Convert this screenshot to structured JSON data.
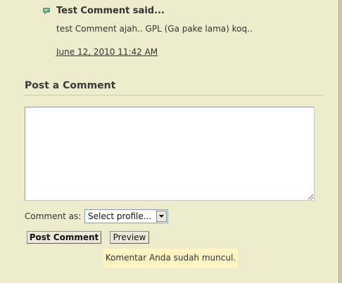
{
  "comment": {
    "icon": "speech-bubble-icon",
    "author_line": "Test Comment said...",
    "body": "test Comment ajah.. GPL (Ga pake lama) koq..",
    "timestamp": "June 12, 2010 11:42 AM"
  },
  "post_comment": {
    "heading": "Post a Comment",
    "textarea_value": "",
    "comment_as_label": "Comment as:",
    "profile_select": {
      "selected": "Select profile...",
      "arrow_icon": "chevron-down-icon"
    },
    "post_button_label": "Post Comment",
    "preview_button_label": "Preview",
    "notice": "Komentar Anda sudah muncul."
  },
  "colors": {
    "background": "#eeeccd",
    "notice_background": "#fff4c2",
    "comment_icon": "#5a9a7a"
  }
}
